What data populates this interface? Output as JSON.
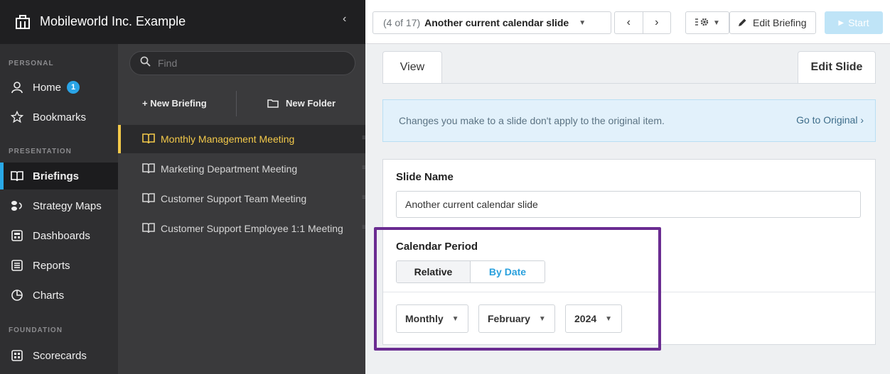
{
  "app": {
    "title": "Mobileworld Inc. Example",
    "collapse_glyph": "‹"
  },
  "nav": {
    "sections": [
      {
        "label": "PERSONAL"
      },
      {
        "label": "PRESENTATION"
      },
      {
        "label": "FOUNDATION"
      }
    ],
    "items": [
      {
        "label": "Home",
        "icon": "user-icon",
        "badge": "1"
      },
      {
        "label": "Bookmarks",
        "icon": "star-icon"
      },
      {
        "label": "Briefings",
        "icon": "book-icon",
        "active": true
      },
      {
        "label": "Strategy Maps",
        "icon": "strategy-map-icon"
      },
      {
        "label": "Dashboards",
        "icon": "dashboard-icon"
      },
      {
        "label": "Reports",
        "icon": "report-icon"
      },
      {
        "label": "Charts",
        "icon": "pie-chart-icon"
      },
      {
        "label": "Scorecards",
        "icon": "scorecard-icon"
      }
    ]
  },
  "briefings_panel": {
    "search_placeholder": "Find",
    "new_briefing_label": "+ New Briefing",
    "new_folder_label": "New Folder",
    "items": [
      {
        "label": "Monthly Management Meeting",
        "active": true
      },
      {
        "label": "Marketing Department Meeting"
      },
      {
        "label": "Customer Support Team Meeting"
      },
      {
        "label": "Customer Support Employee 1:1 Meeting"
      }
    ]
  },
  "toolbar": {
    "slide_count": "(4 of 17)",
    "slide_name": "Another current calendar slide",
    "prev_glyph": "‹",
    "next_glyph": "›",
    "edit_briefing_label": "Edit Briefing",
    "start_label": "Start"
  },
  "tabs": {
    "view": "View",
    "edit": "Edit Slide"
  },
  "notice": {
    "text": "Changes you make to a slide don't apply to the original item.",
    "link": "Go to Original ›"
  },
  "form": {
    "slide_name_label": "Slide Name",
    "slide_name_value": "Another current calendar slide",
    "calendar_period_label": "Calendar Period",
    "period_modes": [
      "Relative",
      "By Date"
    ],
    "selected_mode": "By Date",
    "frequency": "Monthly",
    "month": "February",
    "year": "2024"
  },
  "colors": {
    "accent": "#29a8e6",
    "active_briefing": "#f3c94a",
    "highlight_frame": "#6a2c91",
    "sidebar": "#2f2f31"
  }
}
